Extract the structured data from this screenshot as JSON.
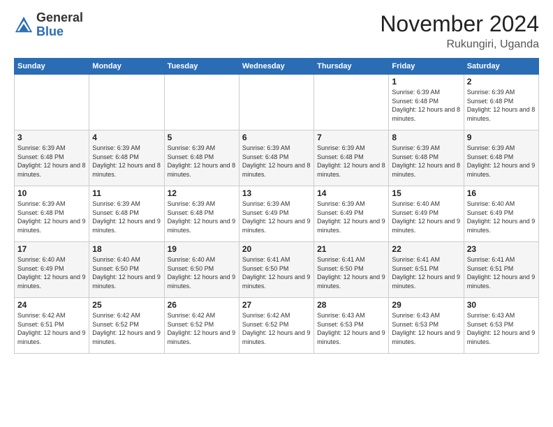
{
  "logo": {
    "general": "General",
    "blue": "Blue"
  },
  "header": {
    "month": "November 2024",
    "location": "Rukungiri, Uganda"
  },
  "weekdays": [
    "Sunday",
    "Monday",
    "Tuesday",
    "Wednesday",
    "Thursday",
    "Friday",
    "Saturday"
  ],
  "weeks": [
    [
      {
        "day": "",
        "info": ""
      },
      {
        "day": "",
        "info": ""
      },
      {
        "day": "",
        "info": ""
      },
      {
        "day": "",
        "info": ""
      },
      {
        "day": "",
        "info": ""
      },
      {
        "day": "1",
        "info": "Sunrise: 6:39 AM\nSunset: 6:48 PM\nDaylight: 12 hours and 8 minutes."
      },
      {
        "day": "2",
        "info": "Sunrise: 6:39 AM\nSunset: 6:48 PM\nDaylight: 12 hours and 8 minutes."
      }
    ],
    [
      {
        "day": "3",
        "info": "Sunrise: 6:39 AM\nSunset: 6:48 PM\nDaylight: 12 hours and 8 minutes."
      },
      {
        "day": "4",
        "info": "Sunrise: 6:39 AM\nSunset: 6:48 PM\nDaylight: 12 hours and 8 minutes."
      },
      {
        "day": "5",
        "info": "Sunrise: 6:39 AM\nSunset: 6:48 PM\nDaylight: 12 hours and 8 minutes."
      },
      {
        "day": "6",
        "info": "Sunrise: 6:39 AM\nSunset: 6:48 PM\nDaylight: 12 hours and 8 minutes."
      },
      {
        "day": "7",
        "info": "Sunrise: 6:39 AM\nSunset: 6:48 PM\nDaylight: 12 hours and 8 minutes."
      },
      {
        "day": "8",
        "info": "Sunrise: 6:39 AM\nSunset: 6:48 PM\nDaylight: 12 hours and 8 minutes."
      },
      {
        "day": "9",
        "info": "Sunrise: 6:39 AM\nSunset: 6:48 PM\nDaylight: 12 hours and 9 minutes."
      }
    ],
    [
      {
        "day": "10",
        "info": "Sunrise: 6:39 AM\nSunset: 6:48 PM\nDaylight: 12 hours and 9 minutes."
      },
      {
        "day": "11",
        "info": "Sunrise: 6:39 AM\nSunset: 6:48 PM\nDaylight: 12 hours and 9 minutes."
      },
      {
        "day": "12",
        "info": "Sunrise: 6:39 AM\nSunset: 6:48 PM\nDaylight: 12 hours and 9 minutes."
      },
      {
        "day": "13",
        "info": "Sunrise: 6:39 AM\nSunset: 6:49 PM\nDaylight: 12 hours and 9 minutes."
      },
      {
        "day": "14",
        "info": "Sunrise: 6:39 AM\nSunset: 6:49 PM\nDaylight: 12 hours and 9 minutes."
      },
      {
        "day": "15",
        "info": "Sunrise: 6:40 AM\nSunset: 6:49 PM\nDaylight: 12 hours and 9 minutes."
      },
      {
        "day": "16",
        "info": "Sunrise: 6:40 AM\nSunset: 6:49 PM\nDaylight: 12 hours and 9 minutes."
      }
    ],
    [
      {
        "day": "17",
        "info": "Sunrise: 6:40 AM\nSunset: 6:49 PM\nDaylight: 12 hours and 9 minutes."
      },
      {
        "day": "18",
        "info": "Sunrise: 6:40 AM\nSunset: 6:50 PM\nDaylight: 12 hours and 9 minutes."
      },
      {
        "day": "19",
        "info": "Sunrise: 6:40 AM\nSunset: 6:50 PM\nDaylight: 12 hours and 9 minutes."
      },
      {
        "day": "20",
        "info": "Sunrise: 6:41 AM\nSunset: 6:50 PM\nDaylight: 12 hours and 9 minutes."
      },
      {
        "day": "21",
        "info": "Sunrise: 6:41 AM\nSunset: 6:50 PM\nDaylight: 12 hours and 9 minutes."
      },
      {
        "day": "22",
        "info": "Sunrise: 6:41 AM\nSunset: 6:51 PM\nDaylight: 12 hours and 9 minutes."
      },
      {
        "day": "23",
        "info": "Sunrise: 6:41 AM\nSunset: 6:51 PM\nDaylight: 12 hours and 9 minutes."
      }
    ],
    [
      {
        "day": "24",
        "info": "Sunrise: 6:42 AM\nSunset: 6:51 PM\nDaylight: 12 hours and 9 minutes."
      },
      {
        "day": "25",
        "info": "Sunrise: 6:42 AM\nSunset: 6:52 PM\nDaylight: 12 hours and 9 minutes."
      },
      {
        "day": "26",
        "info": "Sunrise: 6:42 AM\nSunset: 6:52 PM\nDaylight: 12 hours and 9 minutes."
      },
      {
        "day": "27",
        "info": "Sunrise: 6:42 AM\nSunset: 6:52 PM\nDaylight: 12 hours and 9 minutes."
      },
      {
        "day": "28",
        "info": "Sunrise: 6:43 AM\nSunset: 6:53 PM\nDaylight: 12 hours and 9 minutes."
      },
      {
        "day": "29",
        "info": "Sunrise: 6:43 AM\nSunset: 6:53 PM\nDaylight: 12 hours and 9 minutes."
      },
      {
        "day": "30",
        "info": "Sunrise: 6:43 AM\nSunset: 6:53 PM\nDaylight: 12 hours and 9 minutes."
      }
    ]
  ]
}
